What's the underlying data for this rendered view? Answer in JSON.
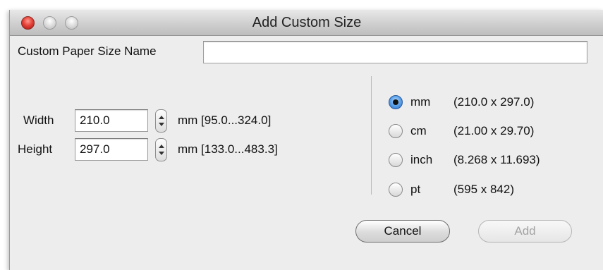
{
  "window": {
    "title": "Add Custom Size"
  },
  "name_field": {
    "label": "Custom Paper Size Name",
    "value": ""
  },
  "width": {
    "label": "Width",
    "value": "210.0",
    "range": "mm [95.0...324.0]"
  },
  "height": {
    "label": "Height",
    "value": "297.0",
    "range": "mm [133.0...483.3]"
  },
  "units": [
    {
      "name": "mm",
      "dims": "(210.0 x 297.0)",
      "selected": true
    },
    {
      "name": "cm",
      "dims": "(21.00 x 29.70)",
      "selected": false
    },
    {
      "name": "inch",
      "dims": "(8.268 x 11.693)",
      "selected": false
    },
    {
      "name": "pt",
      "dims": "(595 x 842)",
      "selected": false
    }
  ],
  "buttons": {
    "cancel": "Cancel",
    "add": "Add"
  },
  "icons": {
    "close": "close-icon",
    "minimize": "minimize-icon",
    "zoom": "zoom-icon",
    "stepper": "stepper-icon"
  },
  "colors": {
    "close_button": "#e5443a",
    "selected_radio": "#5aa0ea",
    "disabled_text": "#a3a3a3"
  }
}
